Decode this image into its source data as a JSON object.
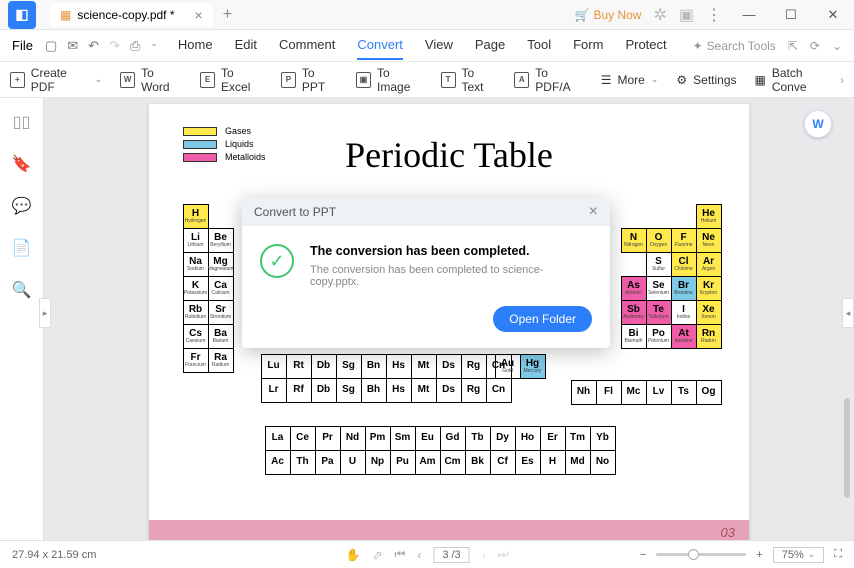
{
  "tab": {
    "title": "science-copy.pdf *"
  },
  "titlebar": {
    "buy": "Buy Now"
  },
  "menubar": {
    "file": "File",
    "tabs": [
      "Home",
      "Edit",
      "Comment",
      "Convert",
      "View",
      "Page",
      "Tool",
      "Form",
      "Protect"
    ],
    "active": "Convert",
    "search_placeholder": "Search Tools"
  },
  "toolbar": {
    "create": "Create PDF",
    "word": "To Word",
    "excel": "To Excel",
    "ppt": "To PPT",
    "image": "To Image",
    "text": "To Text",
    "pdfa": "To PDF/A",
    "more": "More",
    "settings": "Settings",
    "batch": "Batch Conve"
  },
  "page": {
    "title": "Periodic Table",
    "legend": [
      {
        "color": "#ffe94d",
        "label": "Gases"
      },
      {
        "color": "#7ec9e6",
        "label": "Liquids"
      },
      {
        "color": "#ef5da8",
        "label": "Metalloids"
      }
    ],
    "left_block": {
      "top": {
        "sym": "H",
        "name": "Hydrogen",
        "cls": "yellow"
      },
      "rows": [
        [
          {
            "sym": "Li",
            "name": "Lithium"
          },
          {
            "sym": "Be",
            "name": "Beryllium"
          }
        ],
        [
          {
            "sym": "Na",
            "name": "Sodium"
          },
          {
            "sym": "Mg",
            "name": "Magnesium"
          }
        ],
        [
          {
            "sym": "K",
            "name": "Potassium"
          },
          {
            "sym": "Ca",
            "name": "Calcium"
          }
        ],
        [
          {
            "sym": "Rb",
            "name": "Rubidium"
          },
          {
            "sym": "Sr",
            "name": "Strontium"
          }
        ],
        [
          {
            "sym": "Cs",
            "name": "Caesium"
          },
          {
            "sym": "Ba",
            "name": "Barium"
          }
        ],
        [
          {
            "sym": "Fr",
            "name": "Francium"
          },
          {
            "sym": "Ra",
            "name": "Radium"
          }
        ]
      ]
    },
    "right_block": {
      "top": {
        "sym": "He",
        "name": "Helium",
        "cls": "yellow"
      },
      "rows": [
        [
          {
            "sym": "N",
            "name": "Nitrogen",
            "cls": "yellow"
          },
          {
            "sym": "O",
            "name": "Oxygen",
            "cls": "yellow"
          },
          {
            "sym": "F",
            "name": "Fluorine",
            "cls": "yellow"
          },
          {
            "sym": "Ne",
            "name": "Neon",
            "cls": "yellow"
          }
        ],
        [
          {
            "sym": "S",
            "name": "Sulfur"
          },
          {
            "sym": "Cl",
            "name": "Chlorine",
            "cls": "yellow"
          },
          {
            "sym": "Ar",
            "name": "Argon",
            "cls": "yellow"
          }
        ],
        [
          {
            "sym": "As",
            "name": "Arsenic",
            "cls": "pink-c"
          },
          {
            "sym": "Se",
            "name": "Selenium"
          },
          {
            "sym": "Br",
            "name": "Bromine",
            "cls": "blue-c"
          },
          {
            "sym": "Kr",
            "name": "Krypton",
            "cls": "yellow"
          }
        ],
        [
          {
            "sym": "Sb",
            "name": "Antimony",
            "cls": "pink-c"
          },
          {
            "sym": "Te",
            "name": "Tellurium",
            "cls": "pink-c"
          },
          {
            "sym": "I",
            "name": "Iodine"
          },
          {
            "sym": "Xe",
            "name": "Xenon",
            "cls": "yellow"
          }
        ],
        [
          {
            "sym": "Bi",
            "name": "Bismuth"
          },
          {
            "sym": "Po",
            "name": "Polonium"
          },
          {
            "sym": "At",
            "name": "Astatine",
            "cls": "pink-c"
          },
          {
            "sym": "Rn",
            "name": "Radon",
            "cls": "yellow"
          }
        ]
      ]
    },
    "mid_row6": [
      {
        "sym": "Lu"
      },
      {
        "sym": "Rt"
      },
      {
        "sym": "Db"
      },
      {
        "sym": "Sg"
      },
      {
        "sym": "Bn"
      },
      {
        "sym": "Hs"
      },
      {
        "sym": "Mt"
      },
      {
        "sym": "Ds"
      },
      {
        "sym": "Rg"
      },
      {
        "sym": "Cn"
      }
    ],
    "mid_row7": [
      {
        "sym": "Lr"
      },
      {
        "sym": "Rf"
      },
      {
        "sym": "Db"
      },
      {
        "sym": "Sg"
      },
      {
        "sym": "Bh"
      },
      {
        "sym": "Hs"
      },
      {
        "sym": "Mt"
      },
      {
        "sym": "Ds"
      },
      {
        "sym": "Rg"
      },
      {
        "sym": "Cn"
      }
    ],
    "bottom_right_r6": [
      {
        "sym": "Nh"
      },
      {
        "sym": "Fl"
      },
      {
        "sym": "Mc"
      },
      {
        "sym": "Lv"
      },
      {
        "sym": "Ts"
      },
      {
        "sym": "Og"
      }
    ],
    "hg_au": [
      {
        "sym": "Au",
        "name": "Gold"
      },
      {
        "sym": "Hg",
        "name": "Mercury",
        "cls": "blue-c"
      }
    ],
    "lantha": [
      [
        {
          "sym": "La"
        },
        {
          "sym": "Ce"
        },
        {
          "sym": "Pr"
        },
        {
          "sym": "Nd"
        },
        {
          "sym": "Pm"
        },
        {
          "sym": "Sm"
        },
        {
          "sym": "Eu"
        },
        {
          "sym": "Gd"
        },
        {
          "sym": "Tb"
        },
        {
          "sym": "Dy"
        },
        {
          "sym": "Ho"
        },
        {
          "sym": "Er"
        },
        {
          "sym": "Tm"
        },
        {
          "sym": "Yb"
        }
      ],
      [
        {
          "sym": "Ac"
        },
        {
          "sym": "Th"
        },
        {
          "sym": "Pa"
        },
        {
          "sym": "U"
        },
        {
          "sym": "Np"
        },
        {
          "sym": "Pu"
        },
        {
          "sym": "Am"
        },
        {
          "sym": "Cm"
        },
        {
          "sym": "Bk"
        },
        {
          "sym": "Cf"
        },
        {
          "sym": "Es"
        },
        {
          "sym": "H"
        },
        {
          "sym": "Md"
        },
        {
          "sym": "No"
        }
      ]
    ],
    "page_num": "03"
  },
  "dialog": {
    "title": "Convert to PPT",
    "heading": "The conversion has been completed.",
    "message": "The conversion has been completed to science-copy.pptx.",
    "button": "Open Folder"
  },
  "statusbar": {
    "dims": "27.94 x 21.59 cm",
    "page": "3 /3",
    "zoom": "75%"
  }
}
